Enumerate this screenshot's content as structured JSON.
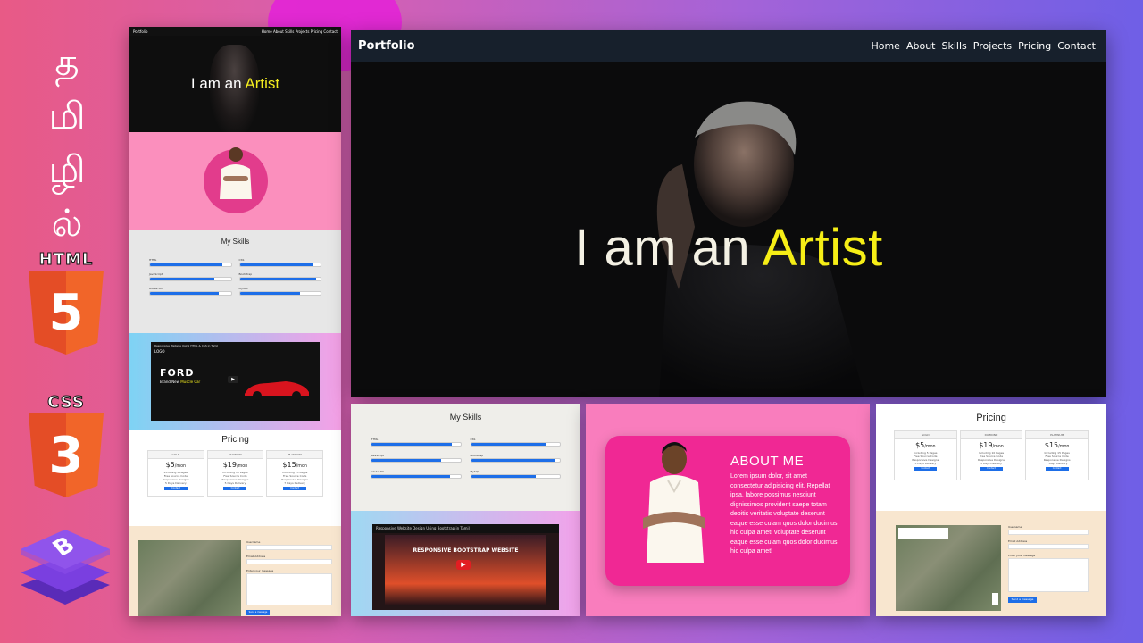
{
  "side_labels": {
    "tamil_chars": [
      "த",
      "மி",
      "ழி",
      "ல்"
    ],
    "html_word": "HTML",
    "html_number": "5",
    "css_word": "CSS",
    "css_number": "3",
    "bootstrap_letter": "B"
  },
  "colors": {
    "accent_yellow": "#f6ee16",
    "nav_bg": "#17202c",
    "about_pink": "#f02894",
    "progress_blue": "#1d6ee8"
  },
  "main_preview": {
    "brand": "Portfolio",
    "nav": [
      "Home",
      "About",
      "Skills",
      "Projects",
      "Pricing",
      "Contact"
    ],
    "hero_prefix": "I am an",
    "hero_highlight": "Artist"
  },
  "left_preview": {
    "brand": "Portfolio",
    "nav": "Home  About  Skills  Projects  Pricing  Contact",
    "hero_prefix": "I am an",
    "hero_highlight": "Artist",
    "skills_title": "My Skills",
    "skills": [
      {
        "name": "HTML",
        "level": 0.9
      },
      {
        "name": "CSS",
        "level": 0.9
      },
      {
        "name": "JavaScript",
        "level": 0.8
      },
      {
        "name": "Bootstrap",
        "level": 0.95
      },
      {
        "name": "Adobe XD",
        "level": 0.85
      },
      {
        "name": "MySQL",
        "level": 0.75
      }
    ],
    "video_title": "Responsive Website Using HTML & CSS in Tamil",
    "video_logo": "LOGO",
    "video_heading": "FORD",
    "video_sub_prefix": "Brand New",
    "video_sub_highlight": "Muscle Car",
    "pricing_title": "Pricing",
    "contact_labels": [
      "Username",
      "Email Address",
      "Enter your message"
    ],
    "send_button": "Send a message"
  },
  "skills_panel": {
    "title": "My Skills",
    "skills": [
      {
        "name": "HTML",
        "level": 0.9
      },
      {
        "name": "CSS",
        "level": 0.85
      },
      {
        "name": "JavaScript",
        "level": 0.78
      },
      {
        "name": "Bootstrap",
        "level": 0.95
      },
      {
        "name": "Adobe XD",
        "level": 0.88
      },
      {
        "name": "MySQL",
        "level": 0.73
      }
    ],
    "video_title": "Responsive Website Design Using Bootstrap in Tamil",
    "video_heading": "RESPONSIVE BOOTSTRAP WEBSITE"
  },
  "about_panel": {
    "title": "ABOUT ME",
    "text": "Lorem ipsum dolor, sit amet consectetur adipisicing elit. Repellat ipsa, labore possimus nesciunt dignissimos provident saepe totam debitis veritatis voluptate deserunt eaque esse culam quos dolor ducimus hic culpa amet! voluptate deserunt eaque esse culam quos dolor ducimus hic culpa amet!"
  },
  "pricing_panel": {
    "title": "Pricing",
    "plans": [
      {
        "name": "GOLD",
        "price": "$5",
        "unit": "/mon",
        "features": [
          "Including 5 Pages",
          "Free Source Code",
          "Responsive Designs",
          "5 Days Delivery"
        ],
        "button": "Contact"
      },
      {
        "name": "DIAMOND",
        "price": "$19",
        "unit": "/mon",
        "features": [
          "Including 10 Pages",
          "Free Source Code",
          "Responsive Designs",
          "5 Days Delivery"
        ],
        "button": "Contact"
      },
      {
        "name": "PLATINUM",
        "price": "$15",
        "unit": "/mon",
        "features": [
          "Including 15 Pages",
          "Free Source Code",
          "Responsive Designs",
          "7 Days Delivery"
        ],
        "button": "Contact"
      }
    ],
    "contact_labels": [
      "Username",
      "Email Address",
      "Enter your message"
    ],
    "send_button": "Send a message"
  }
}
